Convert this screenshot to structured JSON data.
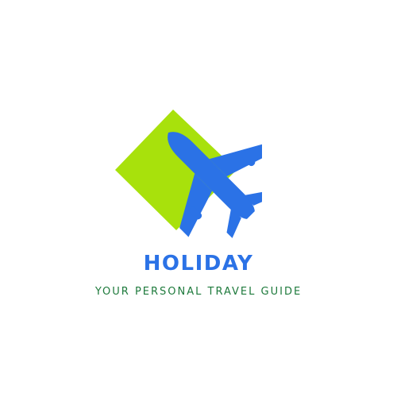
{
  "brand": {
    "name": "HOLIDAY",
    "tagline": "YOUR PERSONAL TRAVEL GUIDE"
  },
  "logo": {
    "shape_icon": "diamond-icon",
    "plane_icon": "airplane-icon"
  },
  "colors": {
    "background": "#ffffff",
    "diamond": "#a8e10c",
    "plane": "#2b72e6",
    "brand_name": "#2b72e6",
    "tagline": "#1e7a3c"
  }
}
